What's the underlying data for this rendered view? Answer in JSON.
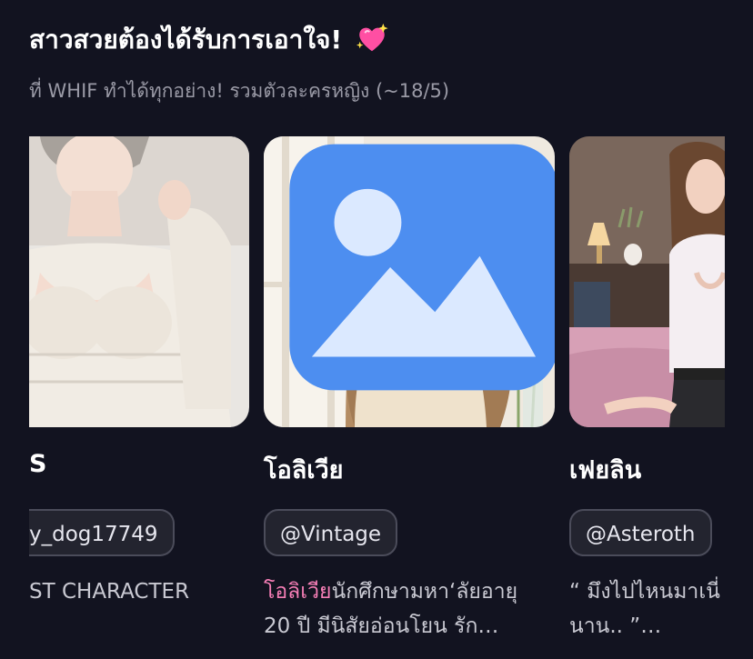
{
  "section": {
    "title": "สาวสวยต้องได้รับการเอาใจ!",
    "subtitle": "ที่ WHIF ทำได้ทุกอย่าง! รวมตัวละครหญิง (~18/5)"
  },
  "cards": [
    {
      "name": "S",
      "creator": "y_dog17749",
      "desc_line1": "ST CHARACTER",
      "desc_line2": ""
    },
    {
      "name": "โอลิเวีย",
      "creator": "@Vintage",
      "desc_highlight": "โอลิเวีย",
      "desc_line1_rest": "นักศึกษามหา‘ลัยอายุ",
      "desc_line2": "20 ปี มีนิสัยอ่อนโยน รัก…",
      "icon": "image-icon"
    },
    {
      "name": "เฟยลิน",
      "creator": "@Asteroth",
      "desc_line1": "“ มึงไปไหนมาเนี่",
      "desc_line2": "นาน.. ”…"
    }
  ],
  "colors": {
    "background": "#121320",
    "highlight": "#f77fb7",
    "pill_border": "#4b4c5a"
  }
}
